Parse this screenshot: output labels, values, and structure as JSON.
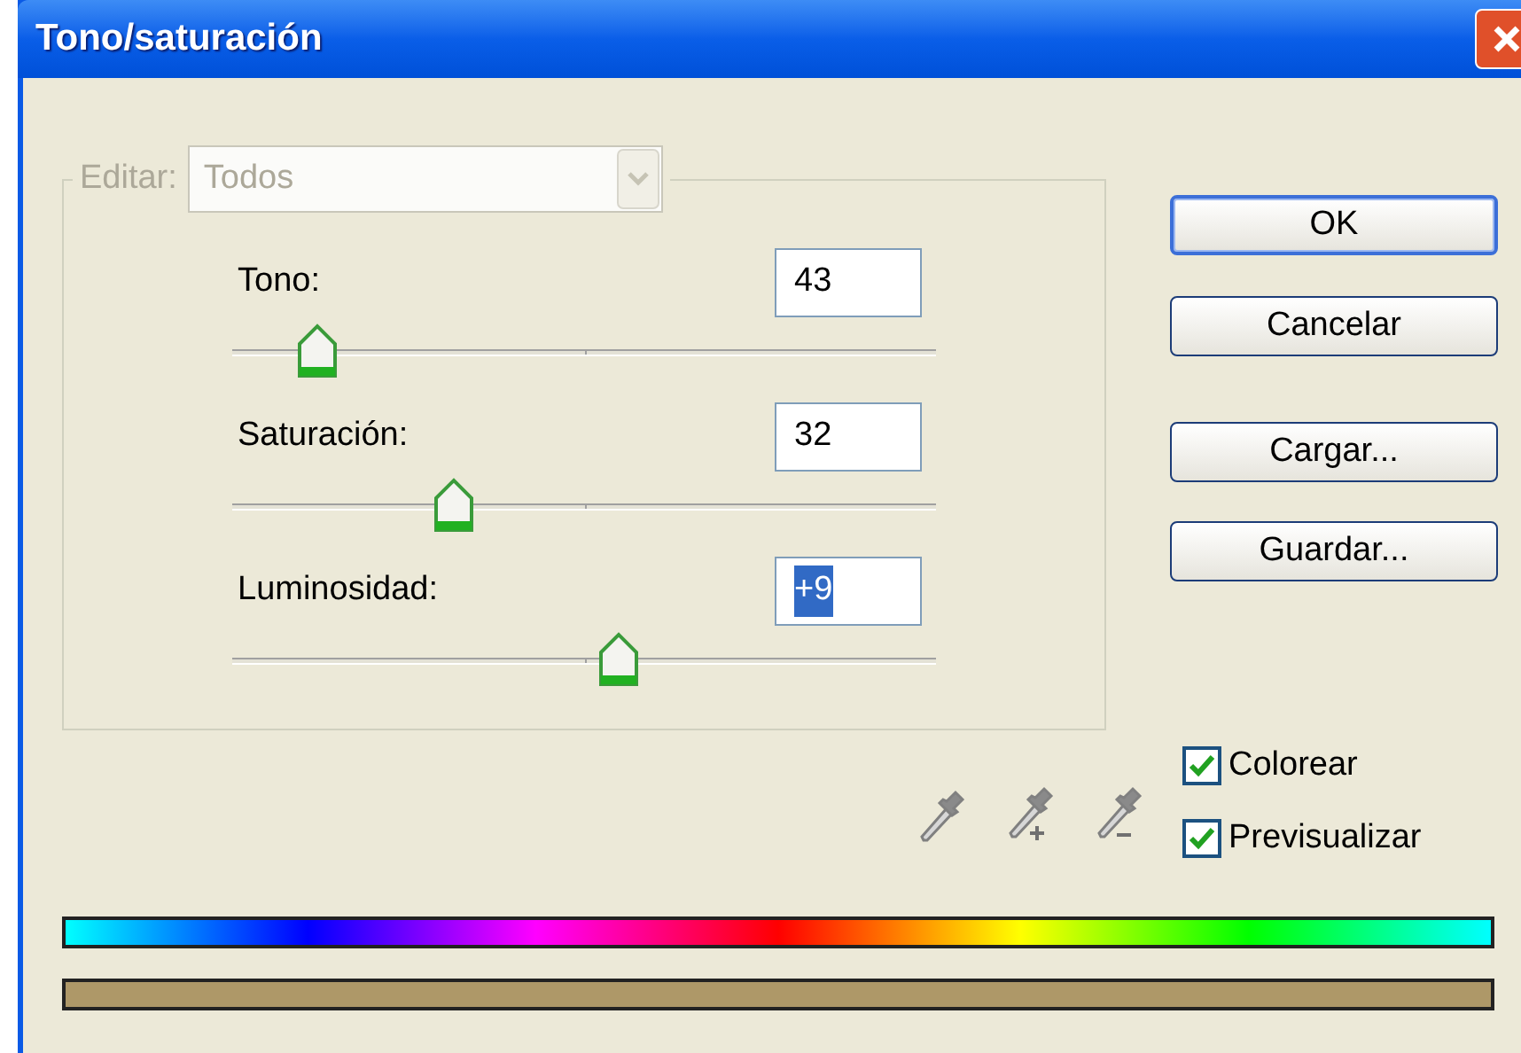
{
  "window": {
    "title": "Tono/saturación"
  },
  "edit": {
    "label": "Editar:",
    "value": "Todos",
    "disabled": true
  },
  "sliders": [
    {
      "label": "Tono:",
      "value": "43",
      "level": 0.12,
      "text_selected": false
    },
    {
      "label": "Saturación:",
      "value": "32",
      "level": 0.315,
      "text_selected": false
    },
    {
      "label": "Luminosidad:",
      "value": "+9",
      "level": 0.548,
      "text_selected": true
    }
  ],
  "buttons": [
    {
      "label": "OK",
      "default": true
    },
    {
      "label": "Cancelar",
      "default": false
    },
    {
      "label": "Cargar...",
      "default": false
    },
    {
      "label": "Guardar...",
      "default": false
    }
  ],
  "options": [
    {
      "label": "Colorear",
      "checked": true
    },
    {
      "label": "Previsualizar",
      "checked": true
    }
  ]
}
